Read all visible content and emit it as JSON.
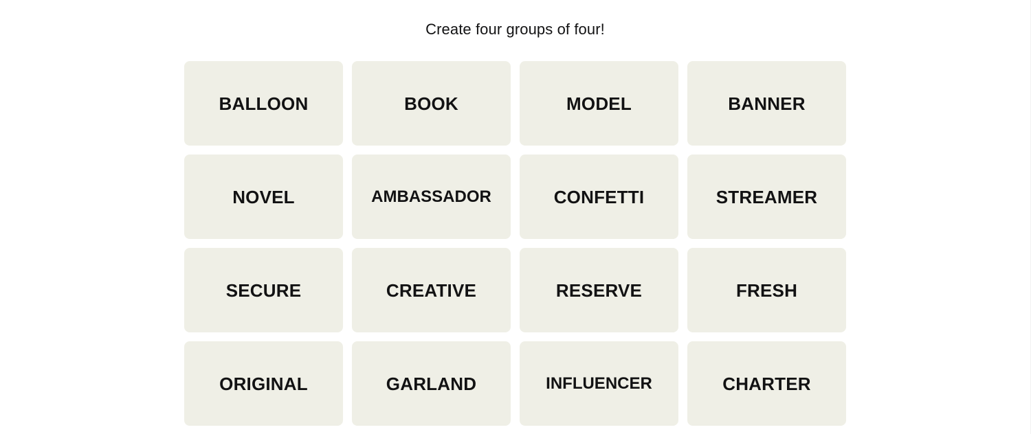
{
  "page": {
    "background_color": "#ffffff"
  },
  "board": {
    "title": "Create four groups of four!",
    "tile_color": "#efefe6",
    "text_color": "#121213",
    "grid": {
      "columns": 4,
      "rows": 4
    },
    "tiles": [
      {
        "label": "BALLOON"
      },
      {
        "label": "BOOK"
      },
      {
        "label": "MODEL"
      },
      {
        "label": "BANNER"
      },
      {
        "label": "NOVEL"
      },
      {
        "label": "AMBASSADOR"
      },
      {
        "label": "CONFETTI"
      },
      {
        "label": "STREAMER"
      },
      {
        "label": "SECURE"
      },
      {
        "label": "CREATIVE"
      },
      {
        "label": "RESERVE"
      },
      {
        "label": "FRESH"
      },
      {
        "label": "ORIGINAL"
      },
      {
        "label": "GARLAND"
      },
      {
        "label": "INFLUENCER"
      },
      {
        "label": "CHARTER"
      }
    ]
  }
}
